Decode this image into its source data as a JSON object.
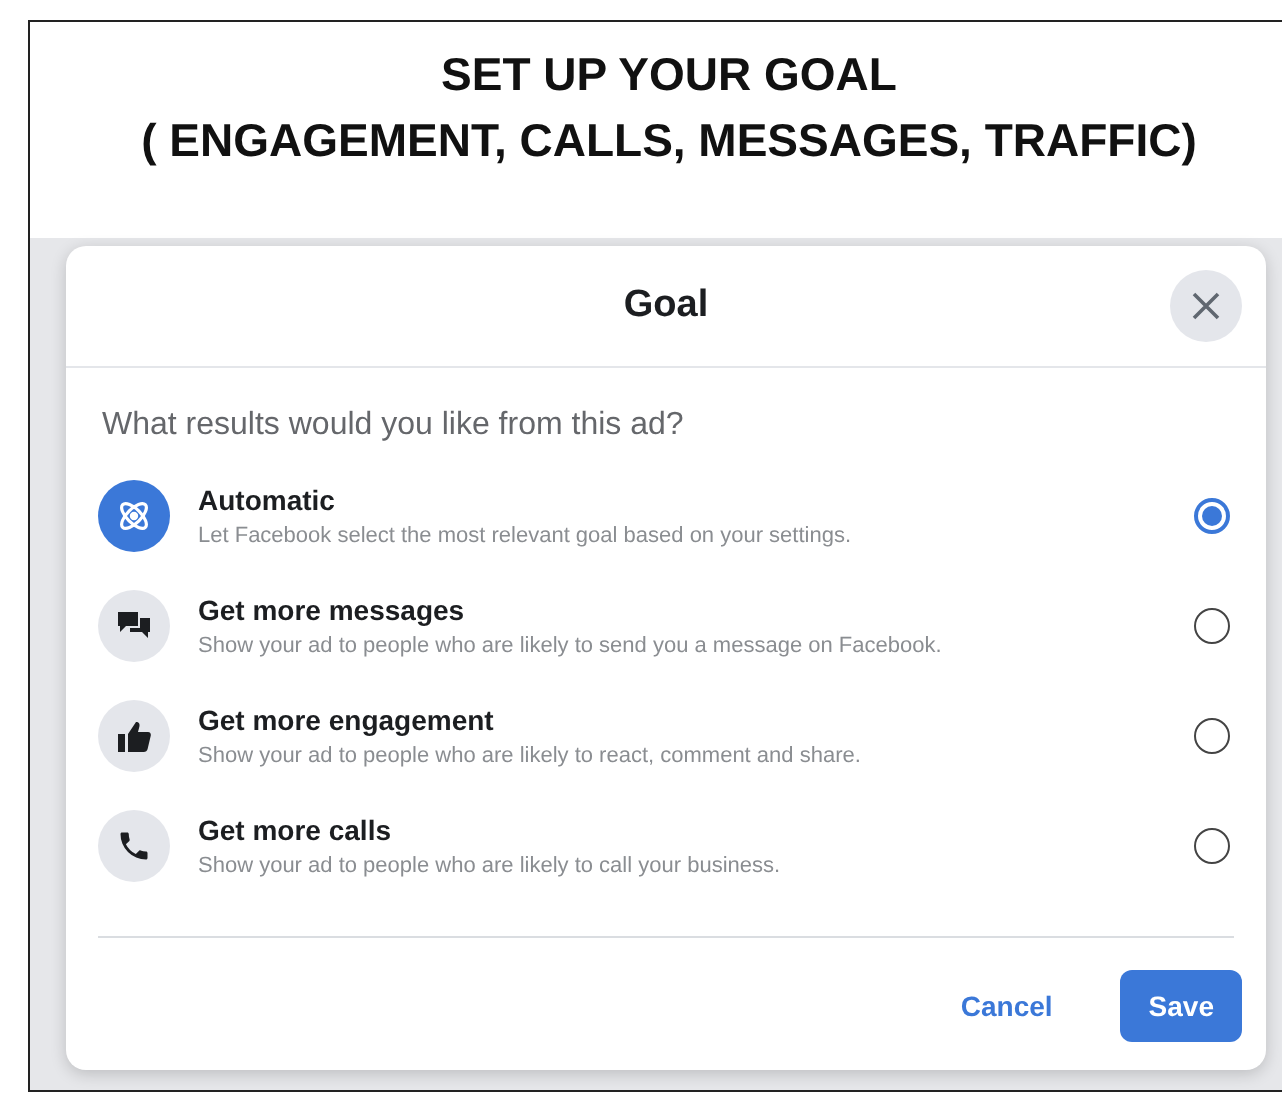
{
  "heading": [
    "SET UP YOUR GOAL",
    "( ENGAGEMENT, CALLS, MESSAGES, TRAFFIC)"
  ],
  "dialog": {
    "title": "Goal",
    "question": "What results would you like from this ad?",
    "options": [
      {
        "kind": "automatic",
        "title": "Automatic",
        "description": "Let Facebook select the most relevant goal based on your settings.",
        "selected": true
      },
      {
        "kind": "messages",
        "title": "Get more messages",
        "description": "Show your ad to people who are likely to send you a message on Facebook.",
        "selected": false
      },
      {
        "kind": "engagement",
        "title": "Get more engagement",
        "description": "Show your ad to people who are likely to react, comment and share.",
        "selected": false
      },
      {
        "kind": "calls",
        "title": "Get more calls",
        "description": "Show your ad to people who are likely to call your business.",
        "selected": false
      }
    ],
    "buttons": [
      {
        "kind": "secondary",
        "label": "Cancel"
      },
      {
        "kind": "primary",
        "label": "Save"
      }
    ]
  }
}
